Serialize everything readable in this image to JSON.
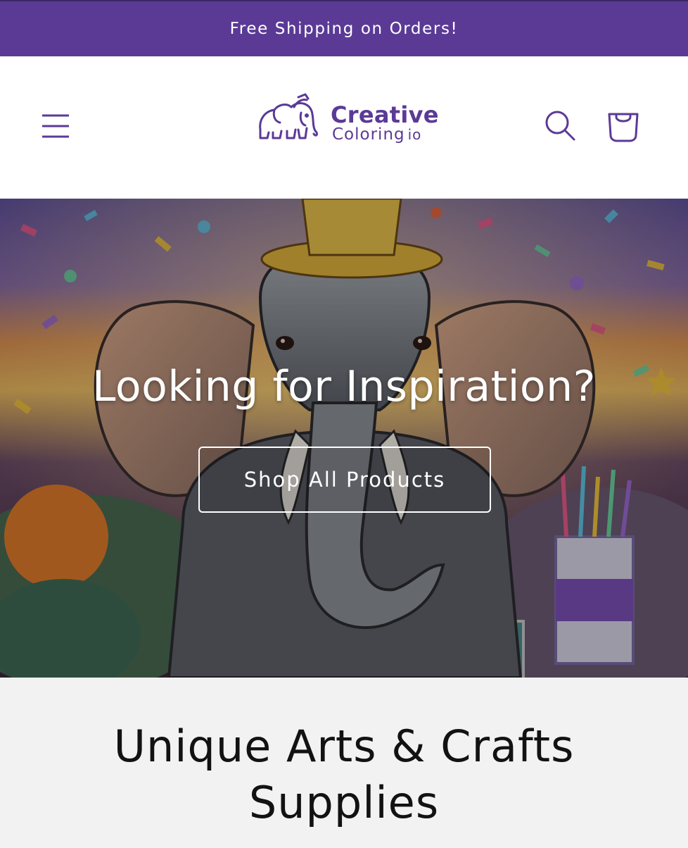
{
  "announcement": {
    "text": "Free Shipping on Orders!"
  },
  "header": {
    "logo": {
      "word1": "Creative",
      "word2": "Coloring",
      "suffix": "io",
      "icon": "elephant-icon"
    },
    "icons": {
      "menu": "menu-icon",
      "search": "search-icon",
      "cart": "cart-icon"
    }
  },
  "hero": {
    "title": "Looking for Inspiration?",
    "button_label": "Shop All Products"
  },
  "section": {
    "title_line1": "Unique Arts & Crafts",
    "title_line2": "Supplies"
  },
  "colors": {
    "brand": "#5b3a96",
    "text": "#121212",
    "section_bg": "#f2f2f2"
  }
}
